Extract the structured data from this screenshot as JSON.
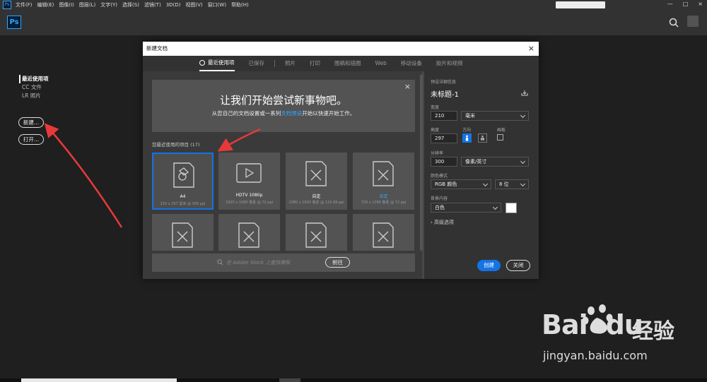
{
  "menubar": {
    "items": [
      "文件(F)",
      "编辑(E)",
      "图像(I)",
      "图层(L)",
      "文字(Y)",
      "选择(S)",
      "滤镜(T)",
      "3D(D)",
      "视图(V)",
      "窗口(W)",
      "帮助(H)"
    ],
    "logo": "Ps",
    "minimize": "—",
    "maximize": "□",
    "close": "×"
  },
  "appbar": {
    "logo": "Ps"
  },
  "home": {
    "nav": [
      "最近使用项",
      "CC 文件",
      "LR 照片"
    ],
    "new_button": "新建...",
    "open_button": "打开..."
  },
  "dialog": {
    "title": "新建文档",
    "close": "×",
    "tabs": [
      "最近使用项",
      "已保存",
      "照片",
      "打印",
      "图稿和插图",
      "Web",
      "移动设备",
      "胶片和视频"
    ],
    "hero": {
      "title": "让我们开始尝试新事物吧。",
      "sub_pre": "从您自己的文档设置或一系列",
      "sub_link": "文档预设",
      "sub_post": "开始以快速开始工作。",
      "close": "×"
    },
    "recent_label": "您最近使用的项目  (17)",
    "cards": [
      {
        "name": "A4",
        "meta": "210 x 297 毫米 @ 300 ppi"
      },
      {
        "name": "HDTV 1080p",
        "meta": "1920 x 1080 像素 @ 72 ppi"
      },
      {
        "name": "自定",
        "meta": "1080 x 1920 像素 @ 119.99 ppi"
      },
      {
        "name": "自定",
        "meta": "720 x 1280 像素 @ 72 ppi"
      }
    ],
    "stock": {
      "placeholder": "在 Adobe Stock 上查找模板",
      "go": "前往"
    },
    "details": {
      "header": "预设详细信息",
      "preset_name": "未标题-1",
      "width_label": "宽度",
      "width_value": "210",
      "width_unit": "毫米",
      "height_label": "高度",
      "height_value": "297",
      "orientation_label": "方向",
      "artboard_label": "画板",
      "resolution_label": "分辨率",
      "resolution_value": "300",
      "resolution_unit": "像素/英寸",
      "color_mode_label": "颜色模式",
      "color_mode": "RGB 颜色",
      "bit_depth": "8 位",
      "bg_label": "背景内容",
      "bg_value": "白色",
      "advanced": "高级选项",
      "create": "创建",
      "close": "关闭"
    }
  },
  "watermark": {
    "logo_bai": "Bai",
    "logo_du": "du",
    "cn": "经验",
    "url": "jingyan.baidu.com"
  },
  "colors": {
    "accent": "#1473e6",
    "ps_blue": "#31a8ff",
    "arrow": "#e8393a"
  }
}
